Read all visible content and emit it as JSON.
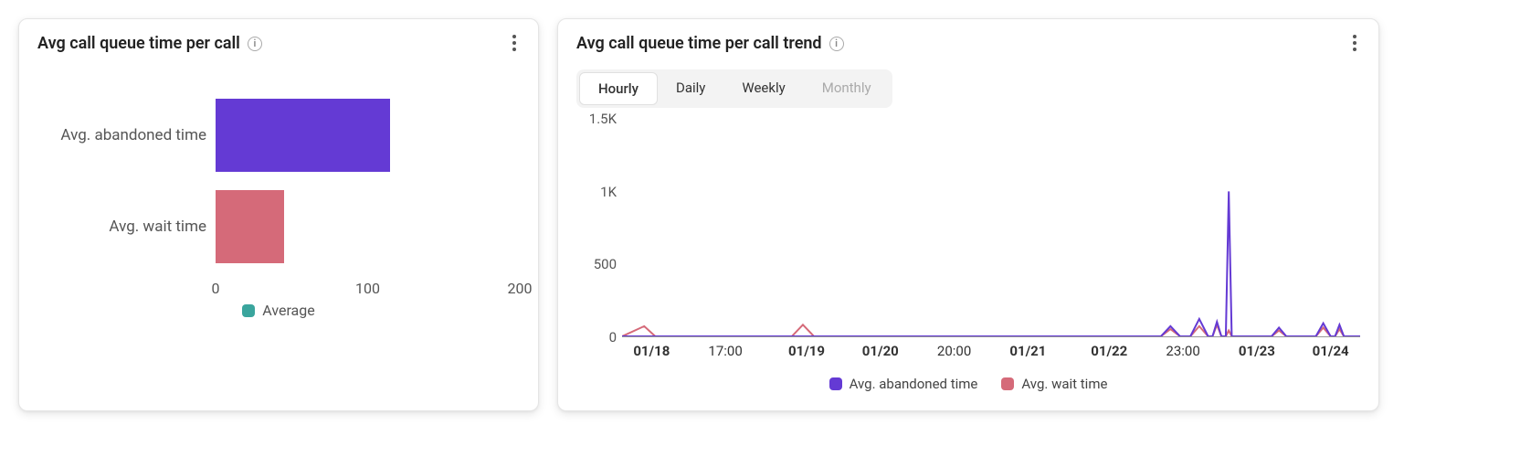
{
  "left_card": {
    "title": "Avg call queue time per call",
    "legend": "Average",
    "axis_ticks": [
      "0",
      "100",
      "200"
    ]
  },
  "right_card": {
    "title": "Avg call queue time per call trend",
    "segments": {
      "hourly": "Hourly",
      "daily": "Daily",
      "weekly": "Weekly",
      "monthly": "Monthly"
    },
    "y_ticks": [
      "0",
      "500",
      "1K",
      "1.5K"
    ],
    "x_ticks": [
      {
        "label": "01/18",
        "bold": true
      },
      {
        "label": "17:00",
        "bold": false
      },
      {
        "label": "01/19",
        "bold": true
      },
      {
        "label": "01/20",
        "bold": true
      },
      {
        "label": "20:00",
        "bold": false
      },
      {
        "label": "01/21",
        "bold": true
      },
      {
        "label": "01/22",
        "bold": true
      },
      {
        "label": "23:00",
        "bold": false
      },
      {
        "label": "01/23",
        "bold": true
      },
      {
        "label": "01/24",
        "bold": true
      }
    ],
    "legend": {
      "a": "Avg. abandoned time",
      "b": "Avg. wait time"
    }
  },
  "chart_data": [
    {
      "type": "bar",
      "orientation": "horizontal",
      "title": "Avg call queue time per call",
      "xlabel": "",
      "ylabel": "",
      "xlim": [
        0,
        200
      ],
      "categories": [
        "Avg. abandoned time",
        "Avg. wait time"
      ],
      "series": [
        {
          "name": "Average",
          "values": [
            115,
            45
          ],
          "colors": [
            "#643ad4",
            "#d56a79"
          ]
        }
      ],
      "legend": [
        "Average"
      ]
    },
    {
      "type": "line",
      "title": "Avg call queue time per call trend",
      "xlabel": "",
      "ylabel": "",
      "ylim": [
        0,
        1500
      ],
      "x": [
        "01/18 00:00",
        "01/18 01:00",
        "01/18 02:00",
        "01/18 03:00",
        "01/18 17:00",
        "01/19 00:00",
        "01/19 01:00",
        "01/19 02:00",
        "01/20 00:00",
        "01/20 20:00",
        "01/21 00:00",
        "01/22 00:00",
        "01/22 17:00",
        "01/22 18:00",
        "01/22 19:00",
        "01/22 20:00",
        "01/22 21:00",
        "01/22 22:00",
        "01/22 23:00",
        "01/23 00:00",
        "01/23 01:00",
        "01/23 02:00",
        "01/23 03:00",
        "01/23 04:00",
        "01/23 05:00",
        "01/23 06:00",
        "01/23 07:00",
        "01/23 08:00",
        "01/23 09:00",
        "01/23 10:00",
        "01/23 11:00",
        "01/23 12:00",
        "01/23 13:00",
        "01/23 14:00",
        "01/23 15:00",
        "01/23 16:00",
        "01/23 17:00",
        "01/24 00:00"
      ],
      "series": [
        {
          "name": "Avg. abandoned time",
          "color": "#643ad4",
          "values": [
            0,
            0,
            0,
            0,
            0,
            0,
            0,
            0,
            0,
            0,
            0,
            0,
            0,
            70,
            0,
            0,
            120,
            0,
            100,
            0,
            1000,
            0,
            0,
            0,
            0,
            0,
            0,
            0,
            60,
            0,
            0,
            0,
            0,
            90,
            0,
            80,
            0,
            0
          ]
        },
        {
          "name": "Avg. wait time",
          "color": "#d56a79",
          "values": [
            0,
            70,
            0,
            0,
            0,
            0,
            80,
            0,
            0,
            0,
            0,
            0,
            0,
            50,
            0,
            0,
            70,
            0,
            80,
            0,
            40,
            0,
            0,
            0,
            0,
            0,
            0,
            0,
            40,
            0,
            0,
            0,
            0,
            60,
            0,
            50,
            0,
            0
          ]
        }
      ],
      "x_ticks_shown": [
        "01/18",
        "17:00",
        "01/19",
        "01/20",
        "20:00",
        "01/21",
        "01/22",
        "23:00",
        "01/23",
        "01/24"
      ],
      "granularity": "Hourly"
    }
  ]
}
